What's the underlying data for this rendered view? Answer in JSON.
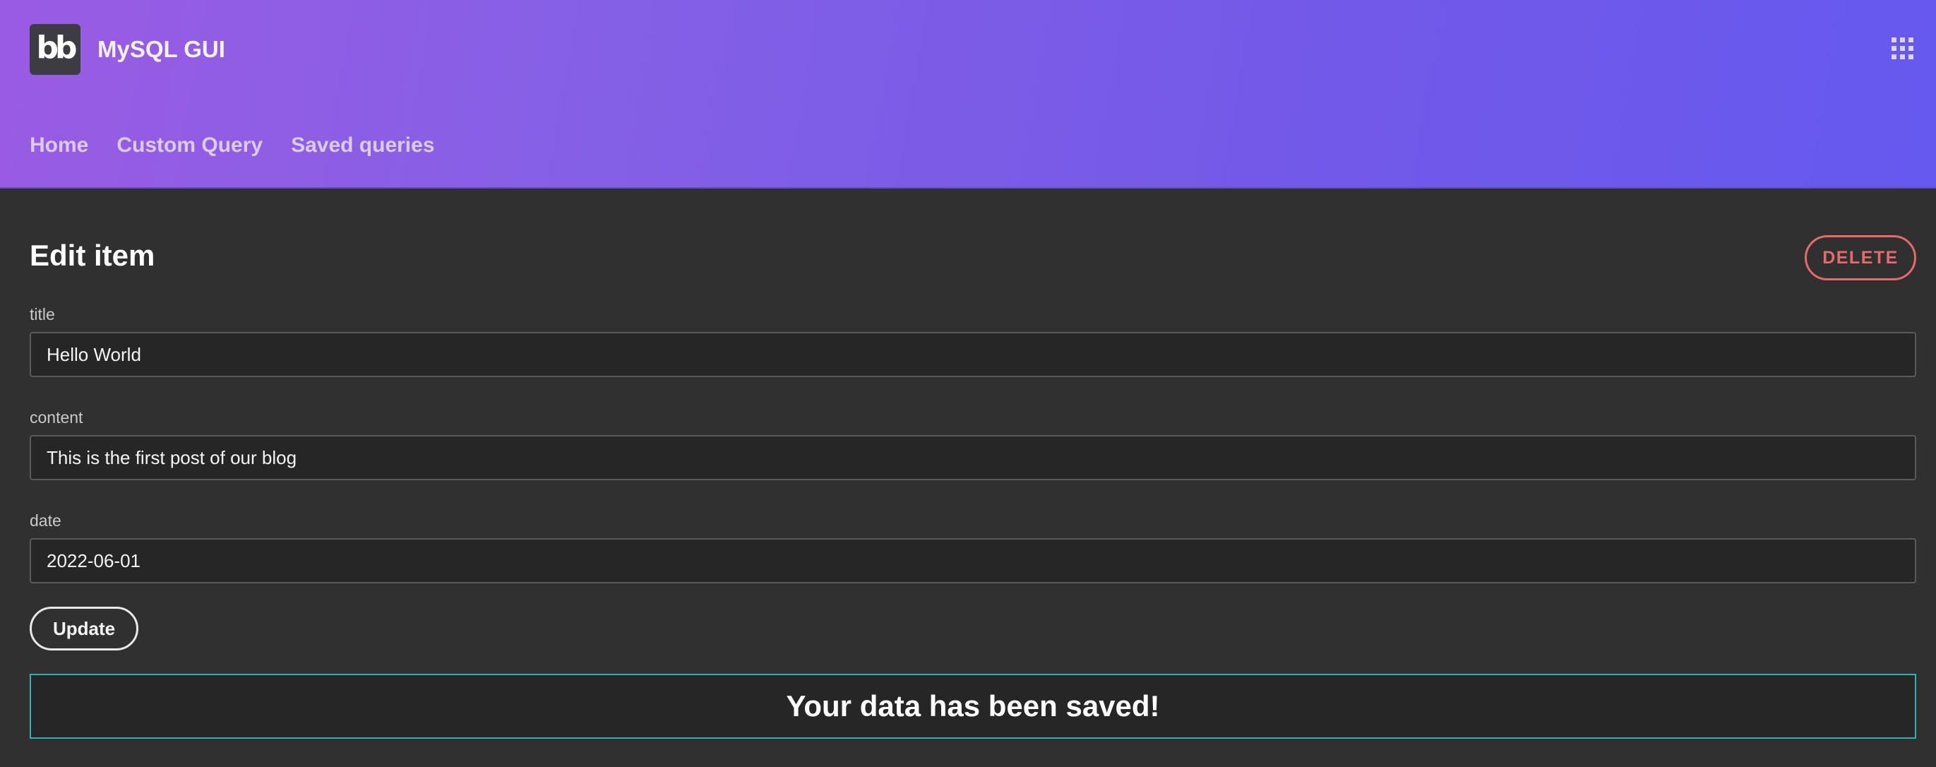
{
  "app": {
    "logo_text": "bb",
    "title": "MySQL GUI"
  },
  "nav": {
    "items": [
      "Home",
      "Custom Query",
      "Saved queries"
    ]
  },
  "form": {
    "title": "Edit item",
    "delete_label": "DELETE",
    "fields": [
      {
        "label": "title",
        "value": "Hello World"
      },
      {
        "label": "content",
        "value": "This is the first post of our blog"
      },
      {
        "label": "date",
        "value": "2022-06-01"
      }
    ],
    "update_label": "Update"
  },
  "notification": {
    "message": "Your data has been saved!"
  },
  "icons": {
    "apps": "grid-apps-icon"
  },
  "colors": {
    "header_gradient_start": "#9a5be4",
    "header_gradient_end": "#6659ef",
    "background": "#303030",
    "input_background": "#262626",
    "delete_accent": "#e76a6a",
    "success_border": "#2bb3b8"
  }
}
